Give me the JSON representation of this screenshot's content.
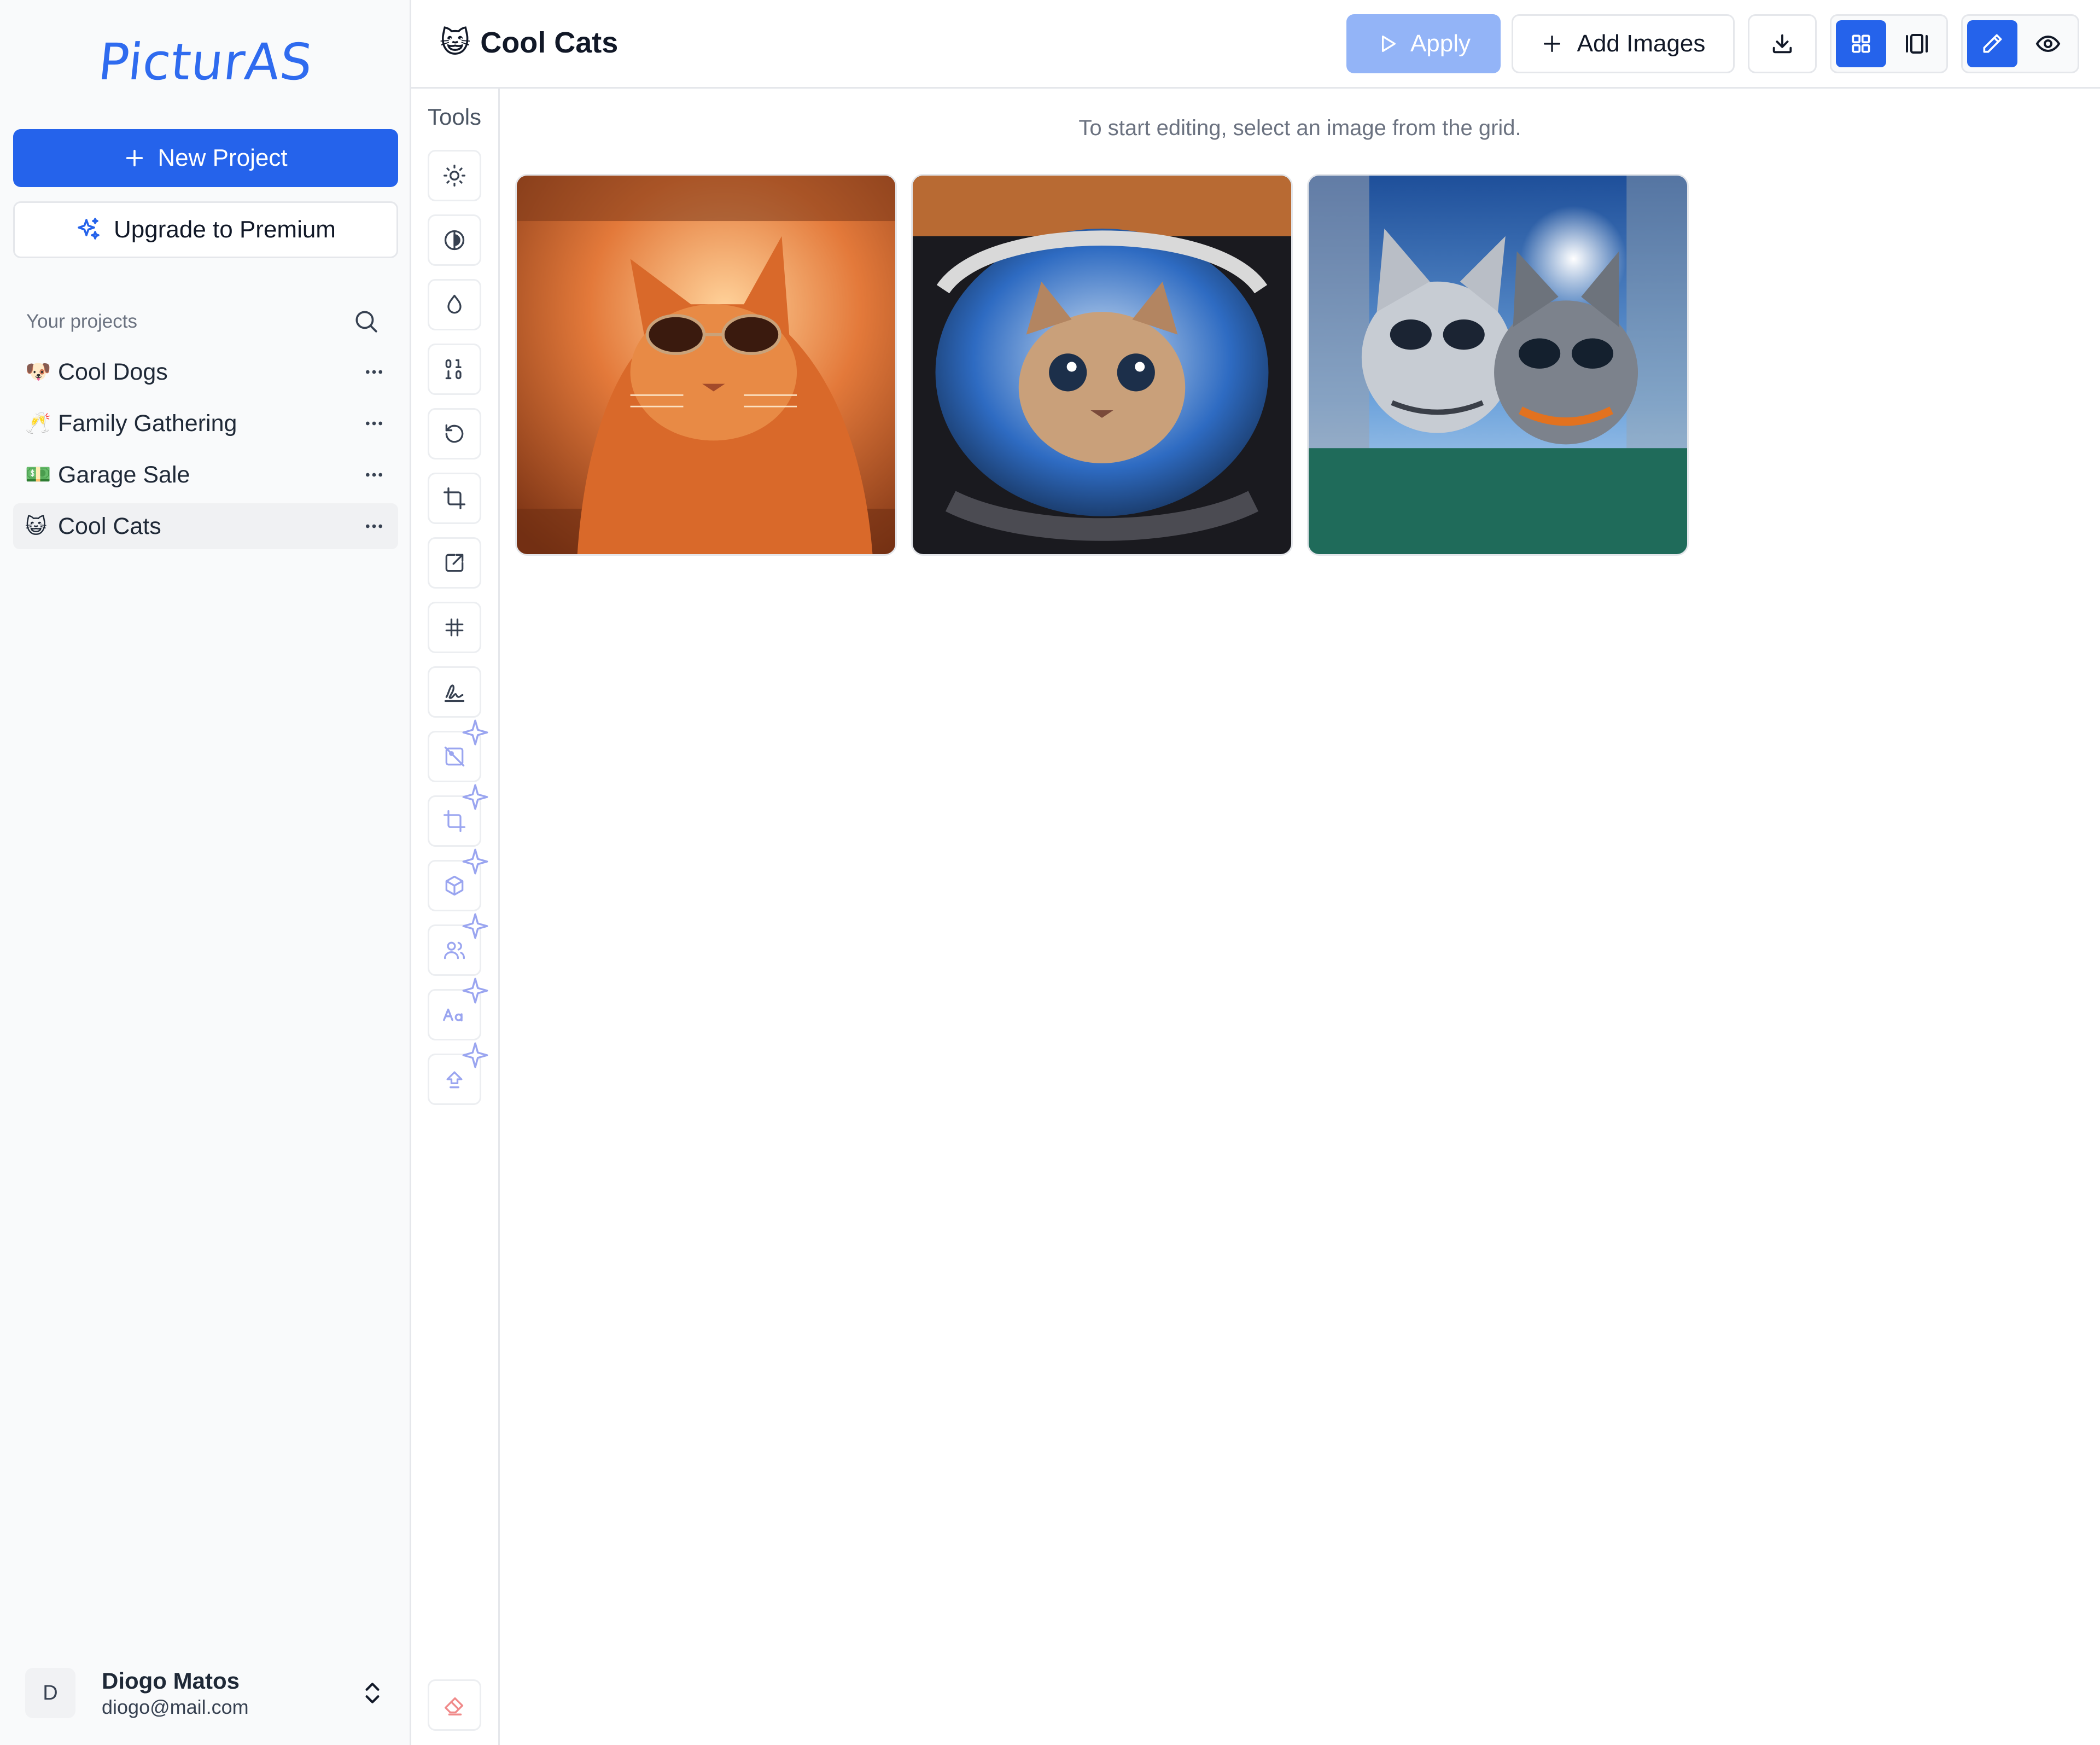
{
  "app": {
    "logo": "PicturAS"
  },
  "sidebar": {
    "new_project_label": "New Project",
    "upgrade_label": "Upgrade to Premium",
    "projects_heading": "Your projects",
    "projects": [
      {
        "emoji": "🐶",
        "name": "Cool Dogs",
        "active": false
      },
      {
        "emoji": "🥂",
        "name": "Family Gathering",
        "active": false
      },
      {
        "emoji": "💵",
        "name": "Garage Sale",
        "active": false
      },
      {
        "emoji": "😺",
        "name": "Cool Cats",
        "active": true
      }
    ],
    "user": {
      "initial": "D",
      "name": "Diogo Matos",
      "email": "diogo@mail.com"
    }
  },
  "header": {
    "title_emoji": "😺",
    "title": "Cool Cats",
    "apply_label": "Apply",
    "add_images_label": "Add Images"
  },
  "tools": {
    "label": "Tools",
    "items": [
      {
        "icon": "brightness-icon",
        "ai": false
      },
      {
        "icon": "contrast-icon",
        "ai": false
      },
      {
        "icon": "saturation-drop-icon",
        "ai": false
      },
      {
        "icon": "binarize-icon",
        "ai": false
      },
      {
        "icon": "rotate-icon",
        "ai": false
      },
      {
        "icon": "crop-icon",
        "ai": false
      },
      {
        "icon": "resize-icon",
        "ai": false
      },
      {
        "icon": "border-icon",
        "ai": false
      },
      {
        "icon": "watermark-signature-icon",
        "ai": false
      },
      {
        "icon": "remove-background-icon",
        "ai": true
      },
      {
        "icon": "smart-crop-icon",
        "ai": true
      },
      {
        "icon": "object-detection-icon",
        "ai": true
      },
      {
        "icon": "people-count-icon",
        "ai": true
      },
      {
        "icon": "text-extraction-icon",
        "ai": true
      },
      {
        "icon": "upscale-icon",
        "ai": true
      }
    ],
    "eraser_icon": "eraser-icon"
  },
  "main": {
    "hint": "To start editing, select an image from the grid.",
    "images": [
      {
        "subject": "orange-cat-sunglasses"
      },
      {
        "subject": "astronaut-cat-helmet"
      },
      {
        "subject": "grey-cats-sunglasses-selfie"
      }
    ]
  },
  "colors": {
    "primary": "#2563eb",
    "primary_disabled": "#93b4f7",
    "ai_accent": "#9aa5f0",
    "border": "#e5e7eb",
    "sidebar_bg": "#f9fafb"
  }
}
